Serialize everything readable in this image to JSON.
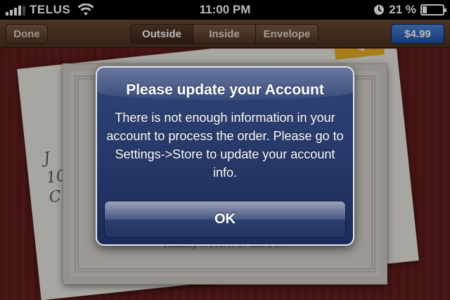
{
  "status_bar": {
    "carrier": "TELUS",
    "time": "11:00 PM",
    "battery_text": "21 %",
    "battery_level": 0.21,
    "icons": [
      "signal-bars-icon",
      "wifi-icon",
      "clock-icon",
      "battery-icon"
    ]
  },
  "toolbar": {
    "done_label": "Done",
    "tabs": [
      {
        "label": "Outside",
        "active": true
      },
      {
        "label": "Inside",
        "active": false
      },
      {
        "label": "Envelope",
        "active": false
      }
    ],
    "price_label": "$4.99"
  },
  "background": {
    "envelope_script": "J\n107\nC",
    "card_caption": "Thinking of you. (I do that a lot)"
  },
  "alert": {
    "title": "Please update your Account",
    "message": "There is not enough information in your account to process the order. Please go to Settings->Store to update your account info.",
    "button_label": "OK"
  },
  "colors": {
    "alert_blue": "#22366e",
    "price_button_blue": "#2f66c2",
    "background_red": "#5e1b1b",
    "stamp_yellow": "#e6b023"
  }
}
